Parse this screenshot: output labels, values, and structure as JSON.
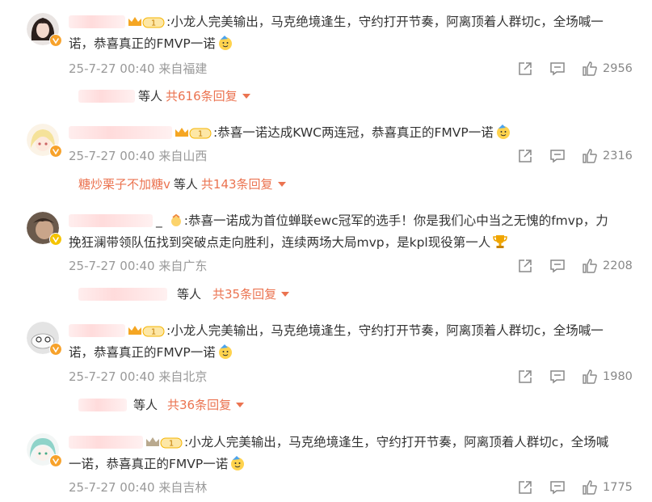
{
  "comments": [
    {
      "text": ":小龙人完美输出，马克绝境逢生，守约打开节奏，阿离顶着人群切c，全场喊一",
      "text2": "诺，恭喜真正的FMVP一诺",
      "time": "25-7-27 00:40",
      "location": "来自福建",
      "likes": "2956",
      "reply_user": "",
      "reply_deng": "等人",
      "reply_total": "共616条回复"
    },
    {
      "text": ":恭喜一诺达成KWC两连冠，恭喜真正的FMVP一诺",
      "text2": "",
      "time": "25-7-27 00:40",
      "location": "来自山西",
      "likes": "2316",
      "reply_user": "糖炒栗子不加糖v",
      "reply_deng": "等人",
      "reply_total": "共143条回复"
    },
    {
      "text": ":恭喜一诺成为首位蝉联ewc冠军的选手！你是我们心中当之无愧的fmvp，力",
      "text2": "挽狂澜带领队伍找到突破点走向胜利，连续两场大局mvp，是kpl现役第一人",
      "time": "25-7-27 00:40",
      "location": "来自广东",
      "likes": "2208",
      "reply_user": "",
      "reply_deng": "等人",
      "reply_total": "共35条回复"
    },
    {
      "text": ":小龙人完美输出，马克绝境逢生，守约打开节奏，阿离顶着人群切c，全场喊一",
      "text2": "诺，恭喜真正的FMVP一诺",
      "time": "25-7-27 00:40",
      "location": "来自北京",
      "likes": "1980",
      "reply_user": "",
      "reply_deng": "等人",
      "reply_total": "共36条回复"
    },
    {
      "text": ":小龙人完美输出，马克绝境逢生，守约打开节奏，阿离顶着人群切c，全场喊",
      "text2": "一诺，恭喜真正的FMVP一诺",
      "time": "25-7-27 00:40",
      "location": "来自吉林",
      "likes": "1775",
      "reply_user": "",
      "reply_deng": "",
      "reply_total": ""
    }
  ],
  "vip_badge_text": "1",
  "icons": {
    "share": "share-icon",
    "comment": "comment-icon",
    "like": "like-icon",
    "caret": "caret-down-icon"
  },
  "colors": {
    "accent": "#eb7350",
    "meta": "#999999",
    "vip_gold": "#f5a623",
    "verified": "#f7a22b"
  }
}
